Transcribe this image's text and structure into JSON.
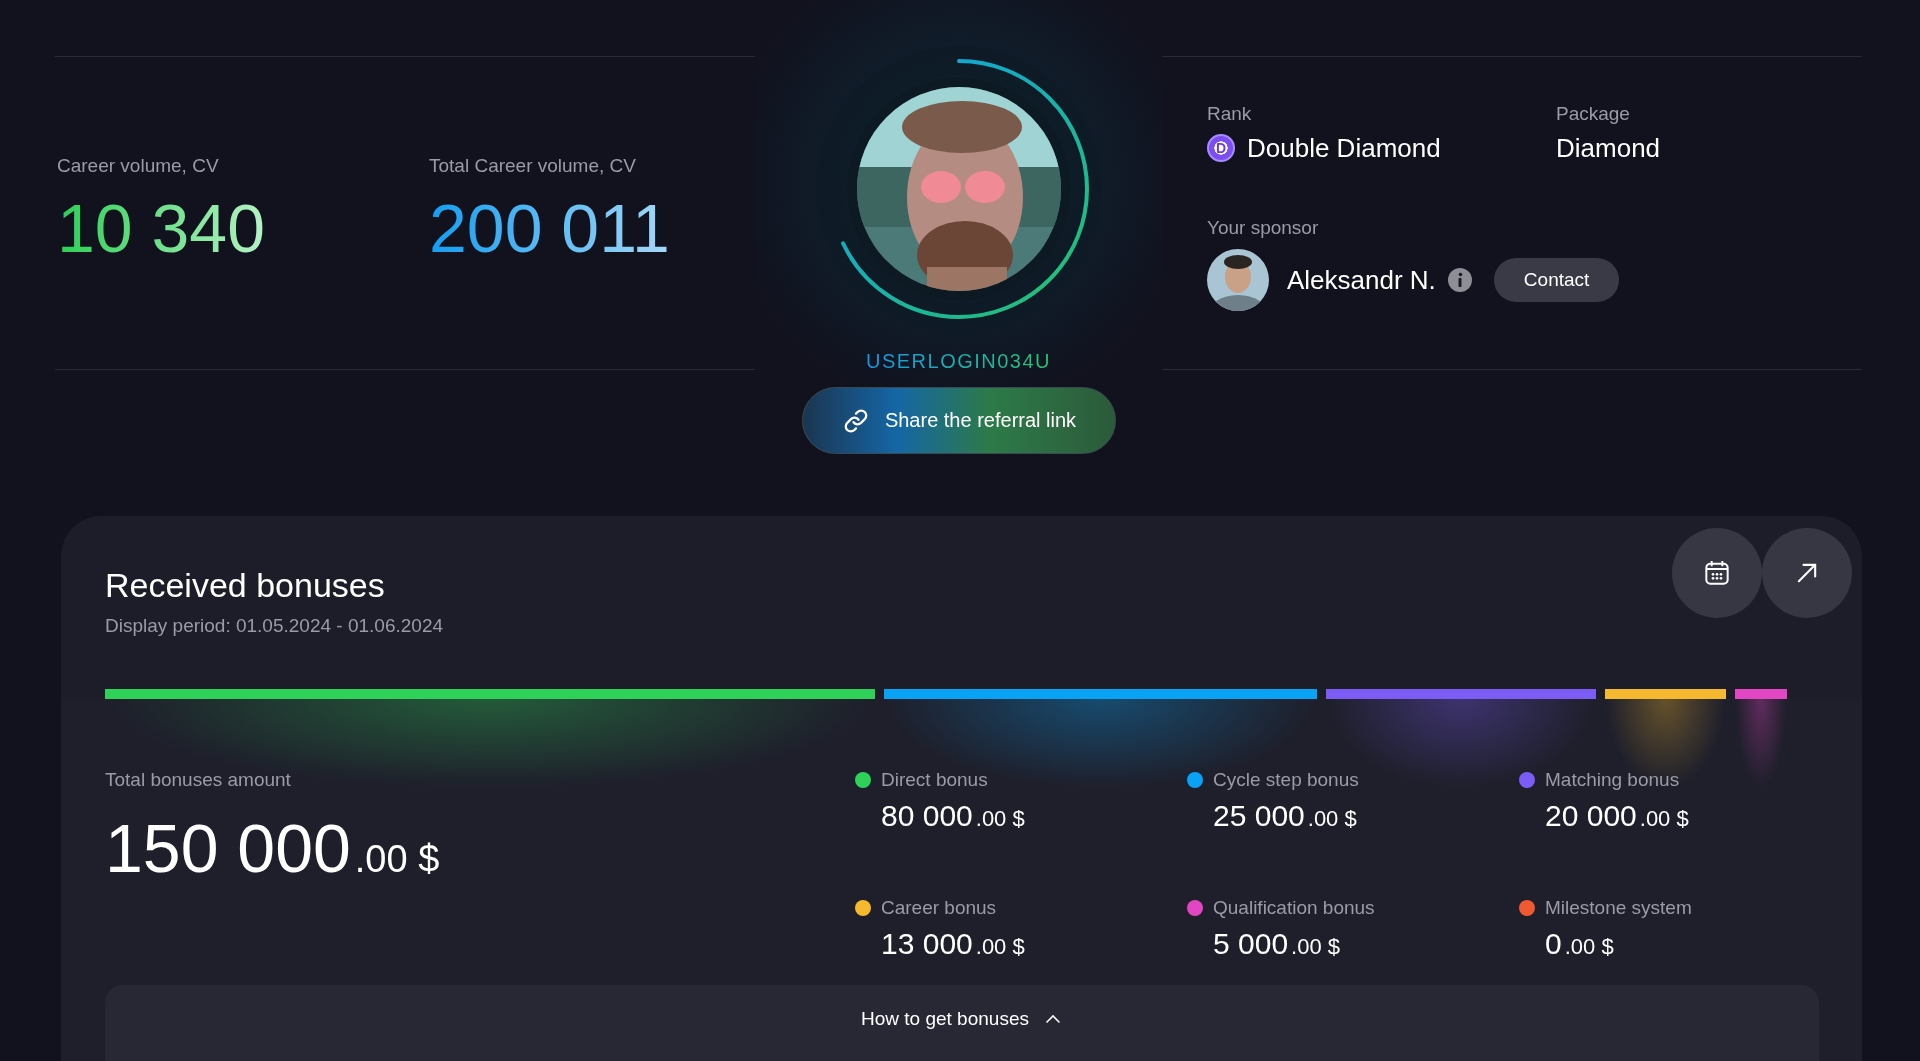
{
  "career_volume": {
    "label": "Career volume, CV",
    "value": "10 340"
  },
  "total_career_volume": {
    "label": "Total Career volume, CV",
    "value": "200 011"
  },
  "profile": {
    "username": "USERLOGIN034U",
    "share_button": "Share the referral link"
  },
  "rank": {
    "label": "Rank",
    "badge": "D",
    "value": "Double Diamond"
  },
  "package": {
    "label": "Package",
    "value": "Diamond"
  },
  "sponsor": {
    "label": "Your sponsor",
    "name": "Aleksandr N.",
    "contact_button": "Contact"
  },
  "bonuses": {
    "title": "Received bonuses",
    "period": "Display period: 01.05.2024 - 01.06.2024",
    "total": {
      "label": "Total bonuses amount",
      "whole": "150 000",
      "cents": ".00 $"
    },
    "items": [
      {
        "label": "Direct bonus",
        "whole": "80 000",
        "cents": ".00 $",
        "color": "#2fd158"
      },
      {
        "label": "Cycle step bonus",
        "whole": "25 000",
        "cents": ".00 $",
        "color": "#0aa2f5"
      },
      {
        "label": "Matching bonus",
        "whole": "20 000",
        "cents": ".00 $",
        "color": "#7b5cf5"
      },
      {
        "label": "Career bonus",
        "whole": "13 000",
        "cents": ".00 $",
        "color": "#f5b82e"
      },
      {
        "label": "Qualification bonus",
        "whole": "5 000",
        "cents": ".00 $",
        "color": "#e246c2"
      },
      {
        "label": "Milestone system",
        "whole": "0",
        "cents": ".00 $",
        "color": "#f05a32"
      }
    ],
    "footer_button": "How to get bonuses"
  }
}
